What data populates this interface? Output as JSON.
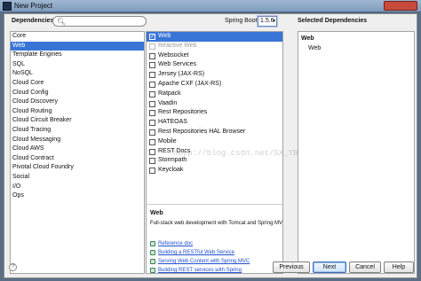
{
  "window": {
    "title": "New Project"
  },
  "header": {
    "dependencies_label": "Dependencies",
    "search_placeholder": "",
    "search_icon": "search-icon",
    "spring_boot_label": "Spring Boot",
    "spring_boot_version": "1.5.6"
  },
  "categories": [
    "Core",
    "Web",
    "Template Engines",
    "SQL",
    "NoSQL",
    "Cloud Core",
    "Cloud Config",
    "Cloud Discovery",
    "Cloud Routing",
    "Cloud Circuit Breaker",
    "Cloud Tracing",
    "Cloud Messaging",
    "Cloud AWS",
    "Cloud Contract",
    "Pivotal Cloud Foundry",
    "Social",
    "I/O",
    "Ops"
  ],
  "selected_category": "Web",
  "options": [
    {
      "label": "Web",
      "checked": true
    },
    {
      "label": "Reactive Web",
      "checked": false,
      "disabled": true
    },
    {
      "label": "Websocket",
      "checked": false
    },
    {
      "label": "Web Services",
      "checked": false
    },
    {
      "label": "Jersey (JAX-RS)",
      "checked": false
    },
    {
      "label": "Apache CXF (JAX-RS)",
      "checked": false
    },
    {
      "label": "Ratpack",
      "checked": false
    },
    {
      "label": "Vaadin",
      "checked": false
    },
    {
      "label": "Rest Repositories",
      "checked": false
    },
    {
      "label": "HATEOAS",
      "checked": false
    },
    {
      "label": "Rest Repositories HAL Browser",
      "checked": false
    },
    {
      "label": "Mobile",
      "checked": false
    },
    {
      "label": "REST Docs",
      "checked": false
    },
    {
      "label": "Stormpath",
      "checked": false
    },
    {
      "label": "Keycloak",
      "checked": false
    }
  ],
  "description": {
    "title": "Web",
    "text": "Full-stack web development with Tomcat and Spring MVC",
    "links": [
      "Reference doc",
      "Building a RESTful Web Service",
      "Serving Web Content with Spring MVC",
      "Building REST services with Spring"
    ]
  },
  "selected_dependencies": {
    "title": "Selected Dependencies",
    "group": "Web",
    "items": [
      "Web"
    ]
  },
  "buttons": {
    "previous": "Previous",
    "next": "Next",
    "cancel": "Cancel",
    "help": "Help"
  },
  "watermark": "http://blog.csdn.net/SX_YBYB",
  "colors": {
    "selection": "#3875d7",
    "link": "#1f4fd1"
  }
}
